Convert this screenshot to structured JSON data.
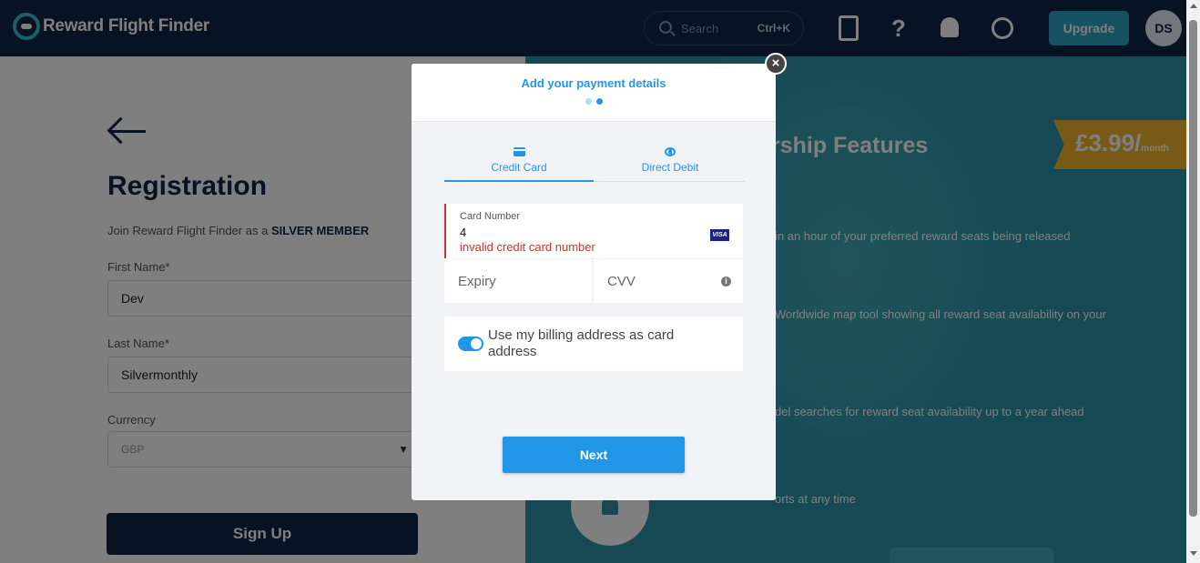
{
  "topbar": {
    "app_name": "Reward Flight Finder",
    "search_placeholder": "Search",
    "search_shortcut": "Ctrl+K",
    "help_glyph": "?",
    "upgrade_label": "Upgrade",
    "avatar_initials": "DS"
  },
  "registration": {
    "title": "Registration",
    "subtitle_prefix": "Join Reward Flight Finder as a",
    "subtitle_tier": "SILVER MEMBER",
    "first_name_label": "First Name*",
    "first_name_value": "Dev",
    "last_name_label": "Last Name*",
    "last_name_value": "Silvermonthly",
    "currency_label": "Currency",
    "currency_value": "GBP",
    "signup_label": "Sign Up"
  },
  "features": {
    "title": "rship Features",
    "price": "£3.99/",
    "price_unit": "month",
    "items": [
      "in an hour of your preferred reward seats being released",
      "Worldwide map tool showing all reward seat availability on your",
      "del searches for reward seat availability up to a year ahead",
      "orts at any time"
    ]
  },
  "modal": {
    "title": "Add your payment details",
    "close_glyph": "×",
    "steps": [
      {
        "active": false
      },
      {
        "active": true
      }
    ],
    "tabs": [
      {
        "label": "Credit Card",
        "active": true
      },
      {
        "label": "Direct Debit",
        "active": false
      }
    ],
    "card_number_label": "Card Number",
    "card_number_value": "4",
    "card_number_error": "invalid credit card number",
    "card_brand": "VISA",
    "expiry_placeholder": "Expiry",
    "cvv_placeholder": "CVV",
    "cvv_info_glyph": "i",
    "billing_toggle_on": true,
    "billing_label": "Use my billing address as card address",
    "next_label": "Next"
  }
}
